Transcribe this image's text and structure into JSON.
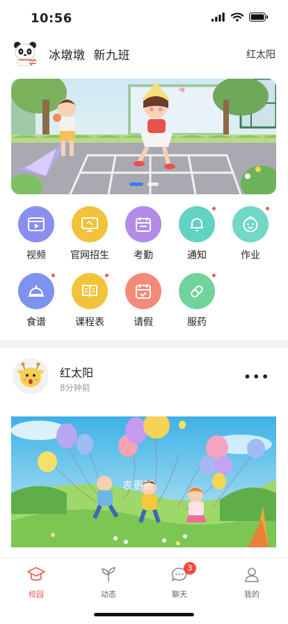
{
  "status_bar": {
    "time": "10:56"
  },
  "header": {
    "school": "冰墩墩",
    "class_name": "新九班",
    "user_name": "红太阳"
  },
  "banner": {
    "slide_count": 2,
    "active_slide": 1
  },
  "functions": [
    {
      "label": "视频",
      "icon": "video-icon",
      "color": "#8a8ef0",
      "badge": false
    },
    {
      "label": "官网招生",
      "icon": "monitor-icon",
      "color": "#f2c23a",
      "badge": false
    },
    {
      "label": "考勤",
      "icon": "calendar-icon",
      "color": "#b48ae8",
      "badge": false
    },
    {
      "label": "通知",
      "icon": "bell-icon",
      "color": "#62d3c0",
      "badge": true
    },
    {
      "label": "作业",
      "icon": "smiley-icon",
      "color": "#70d8c4",
      "badge": true
    },
    {
      "label": "食谱",
      "icon": "cloche-icon",
      "color": "#7d93ee",
      "badge": true
    },
    {
      "label": "课程表",
      "icon": "book-icon",
      "color": "#f2c23a",
      "badge": true
    },
    {
      "label": "请假",
      "icon": "calendar-leave-icon",
      "color": "#f48a7a",
      "badge": false
    },
    {
      "label": "服药",
      "icon": "pill-icon",
      "color": "#6fd39a",
      "badge": true
    }
  ],
  "post": {
    "author": "红太阳",
    "time": "8分钟前",
    "overlay_text": "表更新"
  },
  "tabbar": {
    "tabs": [
      {
        "label": "校园",
        "icon": "graduation-cap-icon",
        "active": true
      },
      {
        "label": "动态",
        "icon": "sprout-icon",
        "active": false
      },
      {
        "label": "聊天",
        "icon": "chat-icon",
        "active": false,
        "badge": "3"
      },
      {
        "label": "我的",
        "icon": "person-icon",
        "active": false
      }
    ]
  },
  "colors": {
    "accent": "#e8584a",
    "badge": "#f04b3c",
    "banner_dot_active": "#3b7bf5"
  }
}
